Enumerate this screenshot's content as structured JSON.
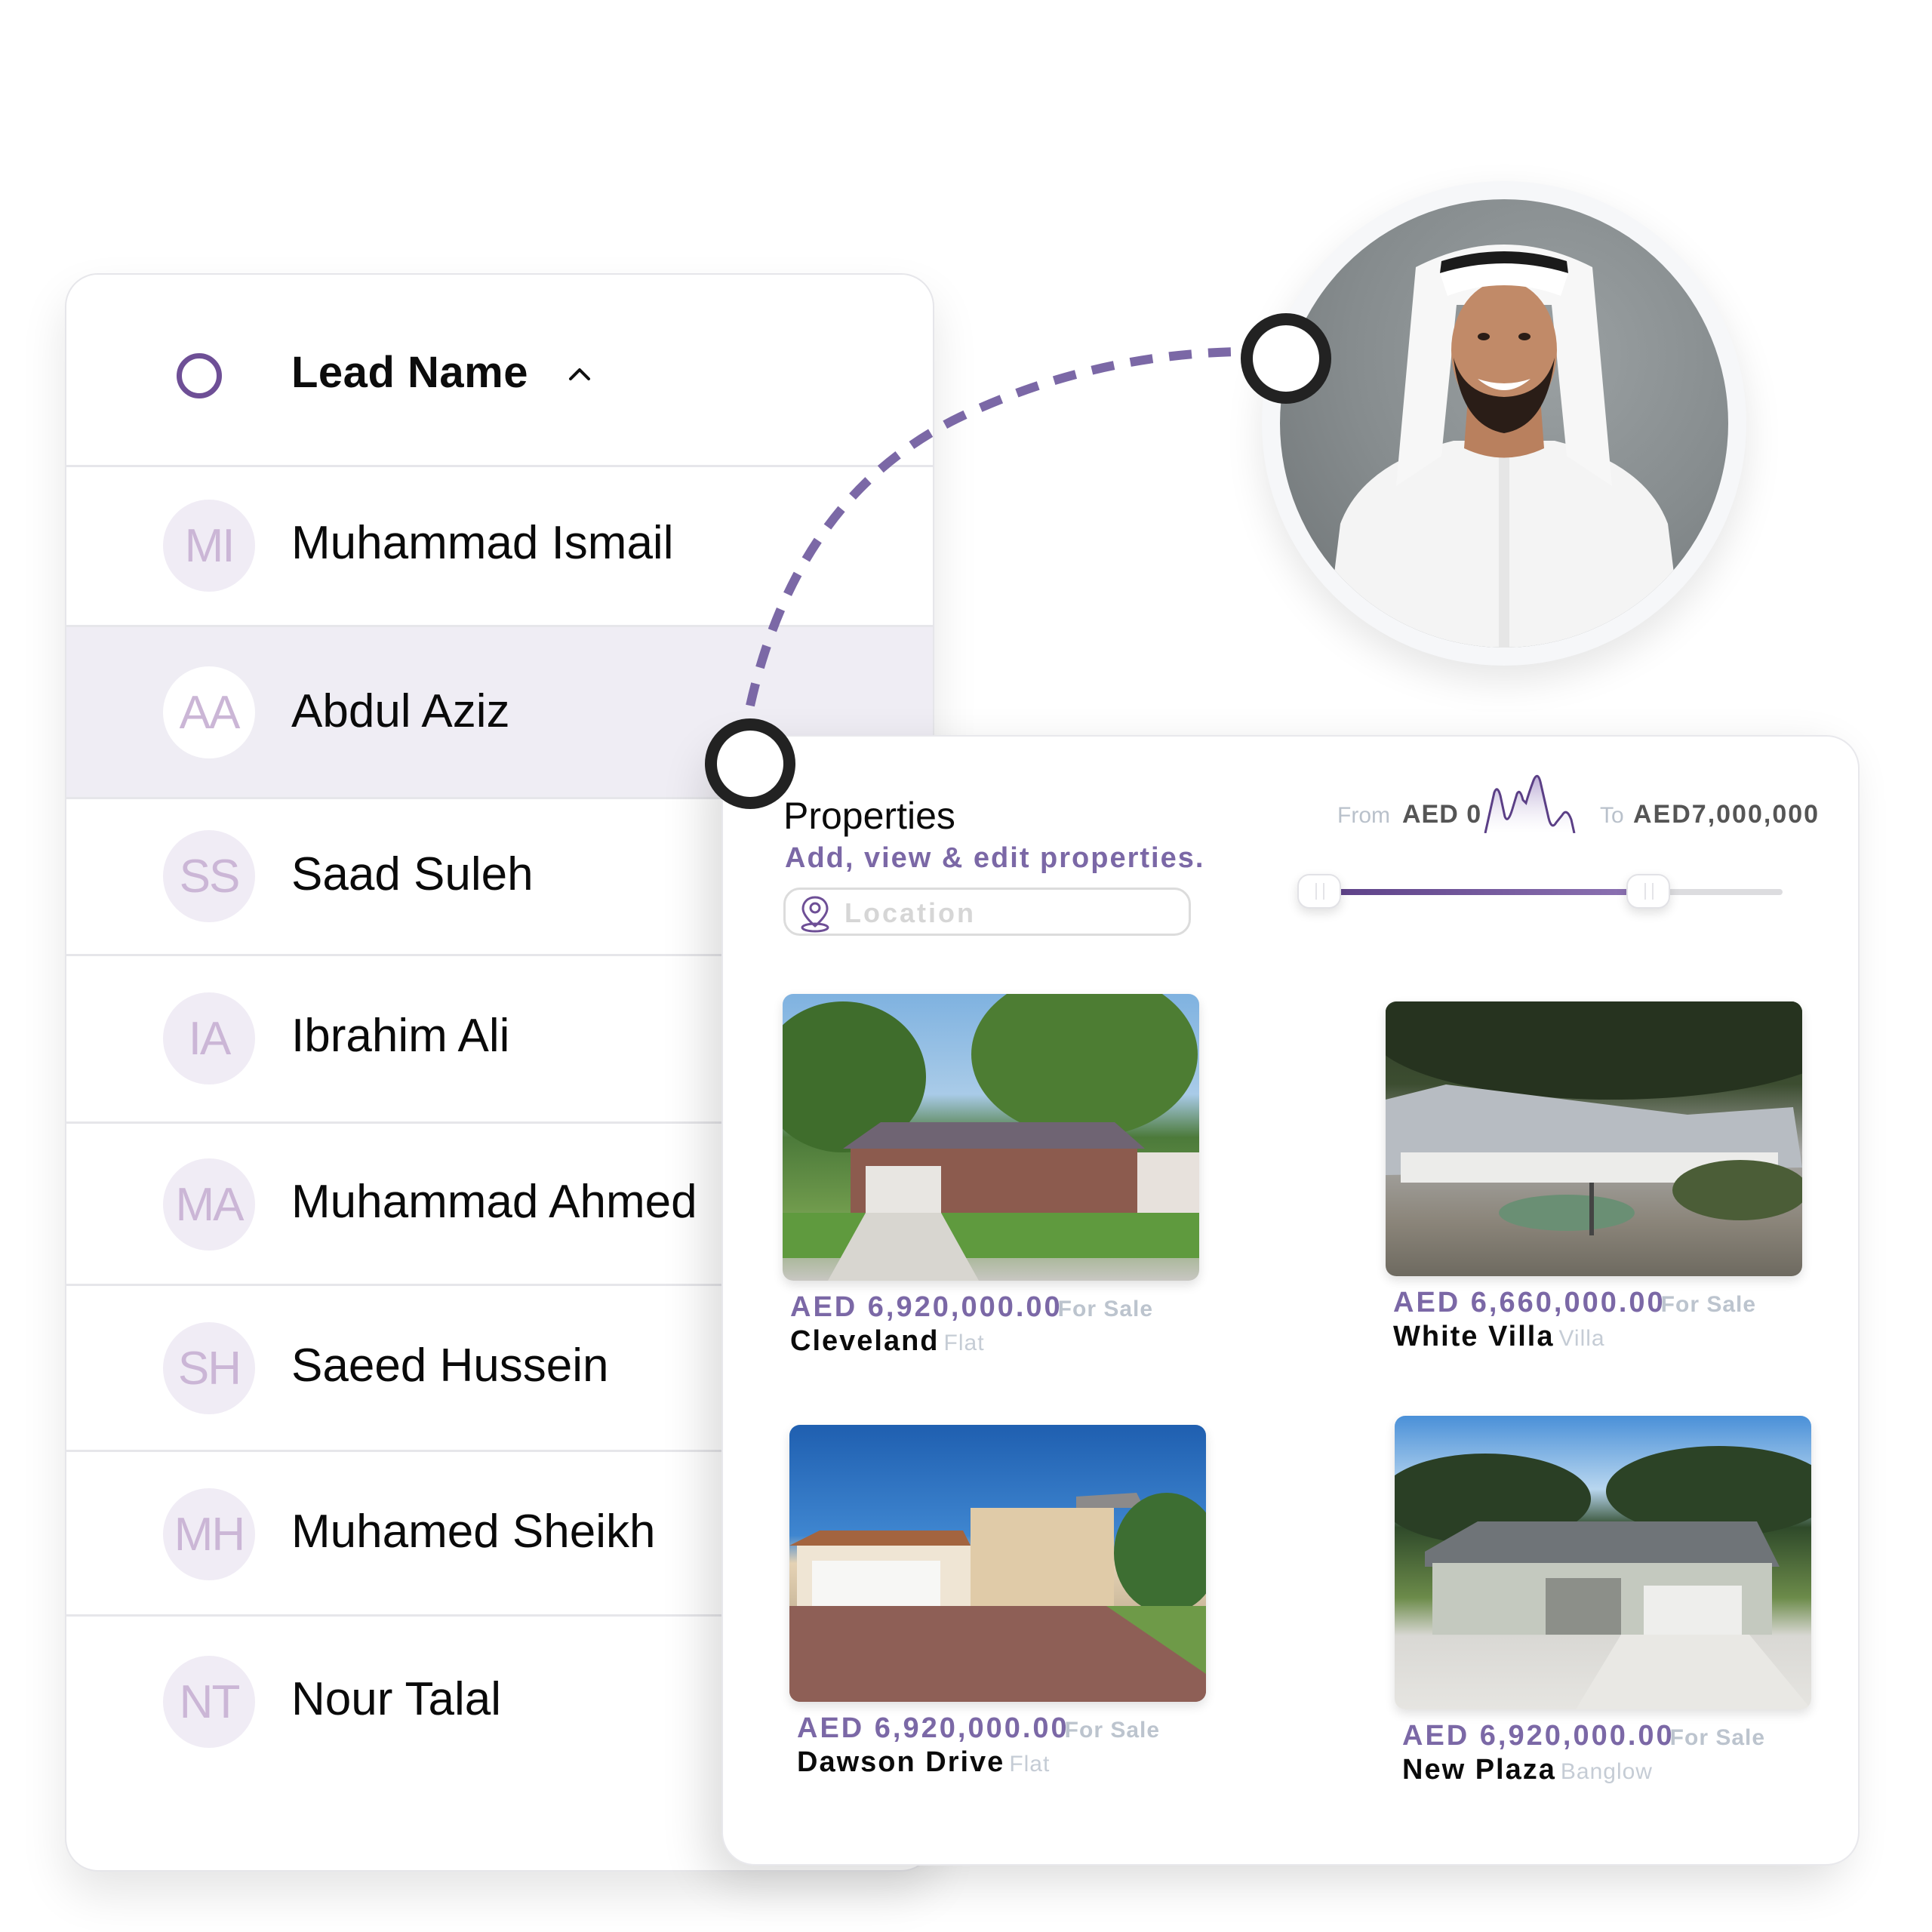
{
  "leads": {
    "header": {
      "title": "Lead Name",
      "sort_icon": "chevron-up-icon",
      "select_all_checked": false
    },
    "rows": [
      {
        "initials": "MI",
        "name": "Muhammad Ismail",
        "selected": false
      },
      {
        "initials": "AA",
        "name": "Abdul Aziz",
        "selected": true
      },
      {
        "initials": "SS",
        "name": "Saad Suleh",
        "selected": false
      },
      {
        "initials": "IA",
        "name": "Ibrahim Ali",
        "selected": false
      },
      {
        "initials": "MA",
        "name": "Muhammad Ahmed",
        "selected": false
      },
      {
        "initials": "SH",
        "name": "Saeed Hussein",
        "selected": false
      },
      {
        "initials": "MH",
        "name": "Muhamed Sheikh",
        "selected": false
      },
      {
        "initials": "NT",
        "name": "Nour Talal",
        "selected": false
      }
    ]
  },
  "profile": {
    "image": "profile-photo-man-in-white-kandura"
  },
  "properties": {
    "title": "Properties",
    "subtitle": "Add, view & edit properties.",
    "location": {
      "placeholder": "Location",
      "value": "",
      "icon": "location-pin-icon"
    },
    "price_range": {
      "from_label": "From",
      "from_value": "AED 0",
      "to_label": "To",
      "to_value": "AED7,000,000",
      "min": 0,
      "max": 7000000,
      "handle_low_fraction": 0.0,
      "handle_high_fraction": 0.72
    },
    "listings": [
      {
        "price": "AED 6,920,000.00",
        "status": "For Sale",
        "name": "Cleveland",
        "type": "Flat",
        "image": "suburban-ranch-house-photo"
      },
      {
        "price": "AED 6,660,000.00",
        "status": "For Sale",
        "name": "White Villa",
        "type": "Villa",
        "image": "white-villa-courtyard-photo"
      },
      {
        "price": "AED 6,920,000.00",
        "status": "For Sale",
        "name": "Dawson Drive",
        "type": "Flat",
        "image": "stucco-house-driveway-photo"
      },
      {
        "price": "AED 6,920,000.00",
        "status": "For Sale",
        "name": "New Plaza",
        "type": "Banglow",
        "image": "gray-bungalow-photo"
      }
    ]
  },
  "colors": {
    "accent": "#7b68a6",
    "accent_dark": "#5b3f86",
    "selected_row": "#efedf4",
    "avatar_bg": "#f0ecf5",
    "avatar_text": "#cbb6d6",
    "muted_text": "#bcc4ce",
    "connector_node": "#222222"
  }
}
